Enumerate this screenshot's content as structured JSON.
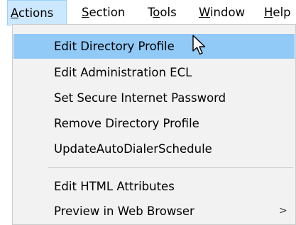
{
  "menubar": {
    "items": [
      {
        "label": "Actions",
        "hotkey_index": 0,
        "active": true
      },
      {
        "label": "Section",
        "hotkey_index": 0,
        "active": false
      },
      {
        "label": "Tools",
        "hotkey_index": 1,
        "active": false
      },
      {
        "label": "Window",
        "hotkey_index": 0,
        "active": false
      },
      {
        "label": "Help",
        "hotkey_index": 0,
        "active": false
      }
    ]
  },
  "menu": {
    "items": [
      {
        "label": "Edit Directory Profile",
        "highlighted": true
      },
      {
        "label": "Edit Administration ECL"
      },
      {
        "label": "Set Secure Internet Password"
      },
      {
        "label": "Remove Directory Profile"
      },
      {
        "label": "UpdateAutoDialerSchedule"
      },
      {
        "label": "Edit HTML Attributes"
      },
      {
        "label": "Preview in Web Browser",
        "submenu_arrow": ">"
      }
    ]
  },
  "colors": {
    "menubar_active_bg": "#cce8ff",
    "menu_bg": "#f2f2f2",
    "highlight_bg": "#91c9f7"
  },
  "icons": {
    "cursor": "pointer-cursor-icon"
  }
}
